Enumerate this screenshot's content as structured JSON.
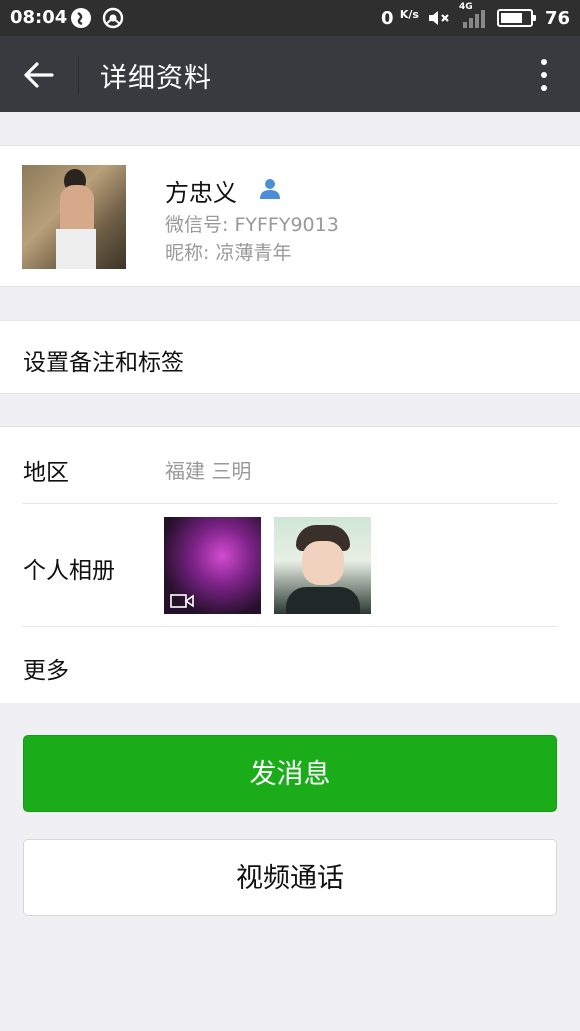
{
  "status_bar": {
    "time": "08:04",
    "net_speed": "0",
    "net_speed_unit": "K/s",
    "signal_label": "4G",
    "battery": "76",
    "battery_fraction": 0.76
  },
  "app_bar": {
    "title": "详细资料"
  },
  "profile": {
    "name": "方忠义",
    "wechat_id": "微信号: FYFFY9013",
    "nickname": "昵称: 凉薄青年"
  },
  "remark": {
    "label": "设置备注和标签"
  },
  "info": {
    "region_label": "地区",
    "region_value": "福建  三明",
    "album_label": "个人相册",
    "more_label": "更多"
  },
  "actions": {
    "send_message": "发消息",
    "video_call": "视频通话"
  },
  "colors": {
    "primary_green": "#1aad19",
    "app_bar": "#393a3f",
    "background": "#efeff4"
  }
}
